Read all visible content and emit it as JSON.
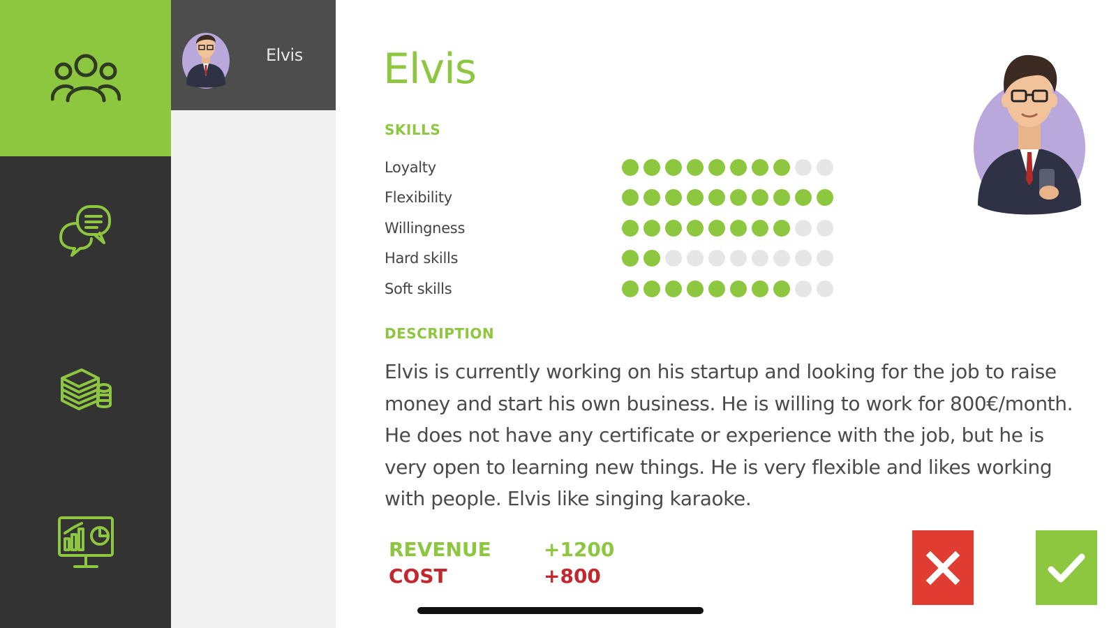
{
  "nav": {
    "items": [
      {
        "icon": "people-group-icon",
        "active": true
      },
      {
        "icon": "chat-bubbles-icon",
        "active": false
      },
      {
        "icon": "money-stack-icon",
        "active": false
      },
      {
        "icon": "analytics-monitor-icon",
        "active": false
      }
    ]
  },
  "candidates": [
    {
      "name": "Elvis",
      "avatar": "man-avatar-icon",
      "selected": true
    }
  ],
  "profile": {
    "name": "Elvis",
    "skills_heading": "SKILLS",
    "skills": [
      {
        "label": "Loyalty",
        "level": 8,
        "max": 10
      },
      {
        "label": "Flexibility",
        "level": 10,
        "max": 10
      },
      {
        "label": "Willingness",
        "level": 8,
        "max": 10
      },
      {
        "label": "Hard skills",
        "level": 2,
        "max": 10
      },
      {
        "label": "Soft skills",
        "level": 8,
        "max": 10
      }
    ],
    "description_heading": "DESCRIPTION",
    "description": "Elvis is currently working on his startup and looking for the job to raise money and start his own business. He is willing to work for 800€/month. He does not have any certificate or experience with the job, but he is very open to learning new things. He is very flexible and likes working with people. Elvis like singing karaoke.",
    "revenue_label": "REVENUE",
    "revenue_value": "+1200",
    "cost_label": "COST",
    "cost_value": "+800"
  },
  "actions": {
    "reject_icon": "close-icon",
    "accept_icon": "check-icon"
  },
  "colors": {
    "accent": "#8dc63f",
    "danger": "#e03c31",
    "cost_text": "#c1272d",
    "rail_bg": "#333333",
    "list_bg": "#f1f1f1",
    "list_selected_bg": "#4d4d4d",
    "dot_off": "#e6e6e6"
  }
}
